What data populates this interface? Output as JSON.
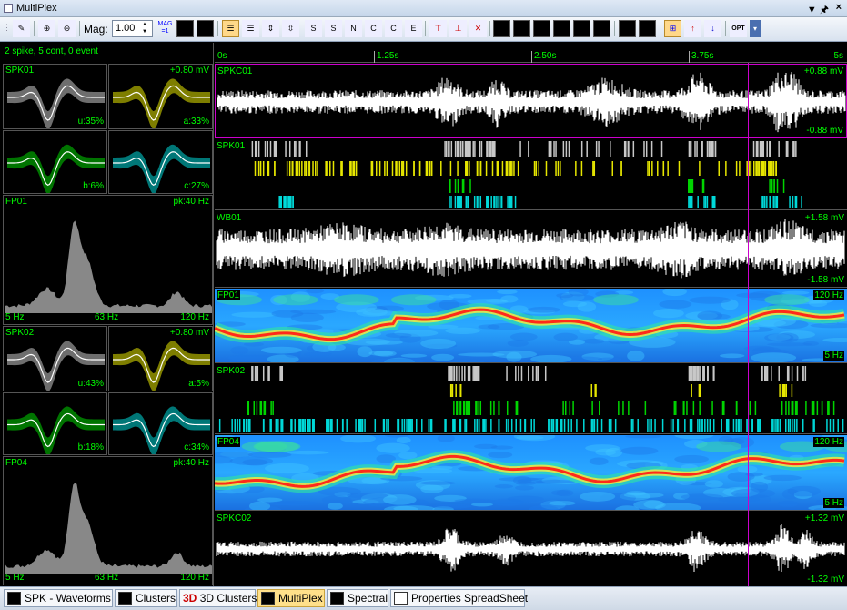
{
  "window": {
    "title": "MultiPlex"
  },
  "toolbar": {
    "mag_label": "Mag:",
    "mag_value": "1.00",
    "mag1_label": "MAG =1",
    "opt_label": "OPT"
  },
  "left": {
    "summary": "2 spike, 5 cont, 0 event",
    "spk01": {
      "name": "SPK01",
      "amp": "+0.80 mV",
      "units": [
        {
          "name": "u",
          "pct": "u:35%",
          "color": "#c8c8c8"
        },
        {
          "name": "a",
          "pct": "a:33%",
          "color": "#e6e600"
        },
        {
          "name": "b",
          "pct": "b:6%",
          "color": "#00d400"
        },
        {
          "name": "c",
          "pct": "c:27%",
          "color": "#00d8d8"
        }
      ]
    },
    "fp01": {
      "name": "FP01",
      "peak": "pk:40 Hz",
      "fmin": "5 Hz",
      "fmid": "63 Hz",
      "fmax": "120 Hz"
    },
    "spk02": {
      "name": "SPK02",
      "amp": "+0.80 mV",
      "units": [
        {
          "name": "u",
          "pct": "u:43%",
          "color": "#c8c8c8"
        },
        {
          "name": "a",
          "pct": "a:5%",
          "color": "#e6e600"
        },
        {
          "name": "b",
          "pct": "b:18%",
          "color": "#00d400"
        },
        {
          "name": "c",
          "pct": "c:34%",
          "color": "#00d8d8"
        }
      ]
    },
    "fp04": {
      "name": "FP04",
      "peak": "pk:40 Hz",
      "fmin": "5 Hz",
      "fmid": "63 Hz",
      "fmax": "120 Hz"
    }
  },
  "timeaxis": {
    "ticks": [
      "0s",
      "1.25s",
      "2.50s",
      "3.75s",
      "5s"
    ]
  },
  "tracks": {
    "spkc01": {
      "name": "SPKC01",
      "top": "+0.88 mV",
      "bottom": "-0.88 mV"
    },
    "spk01": {
      "name": "SPK01"
    },
    "wb01": {
      "name": "WB01",
      "top": "+1.58 mV",
      "bottom": "-1.58 mV"
    },
    "fp01": {
      "name": "FP01",
      "top": "120 Hz",
      "bottom": "5 Hz"
    },
    "spk02": {
      "name": "SPK02"
    },
    "fp04": {
      "name": "FP04",
      "top": "120 Hz",
      "bottom": "5 Hz"
    },
    "spkc02": {
      "name": "SPKC02",
      "top": "+1.32 mV",
      "bottom": "-1.32 mV"
    }
  },
  "tabs": [
    {
      "label": "SPK - Waveforms",
      "active": false
    },
    {
      "label": "Clusters",
      "active": false
    },
    {
      "label": "3D Clusters",
      "prefix": "3D",
      "active": false
    },
    {
      "label": "MultiPlex",
      "active": true
    },
    {
      "label": "Spectral",
      "active": false
    },
    {
      "label": "Properties SpreadSheet",
      "active": false
    }
  ],
  "colors": {
    "accent": "#00ff00",
    "cursor": "#cc00cc",
    "unit_u": "#c8c8c8",
    "unit_a": "#e6e600",
    "unit_b": "#00d400",
    "unit_c": "#00d8d8"
  }
}
